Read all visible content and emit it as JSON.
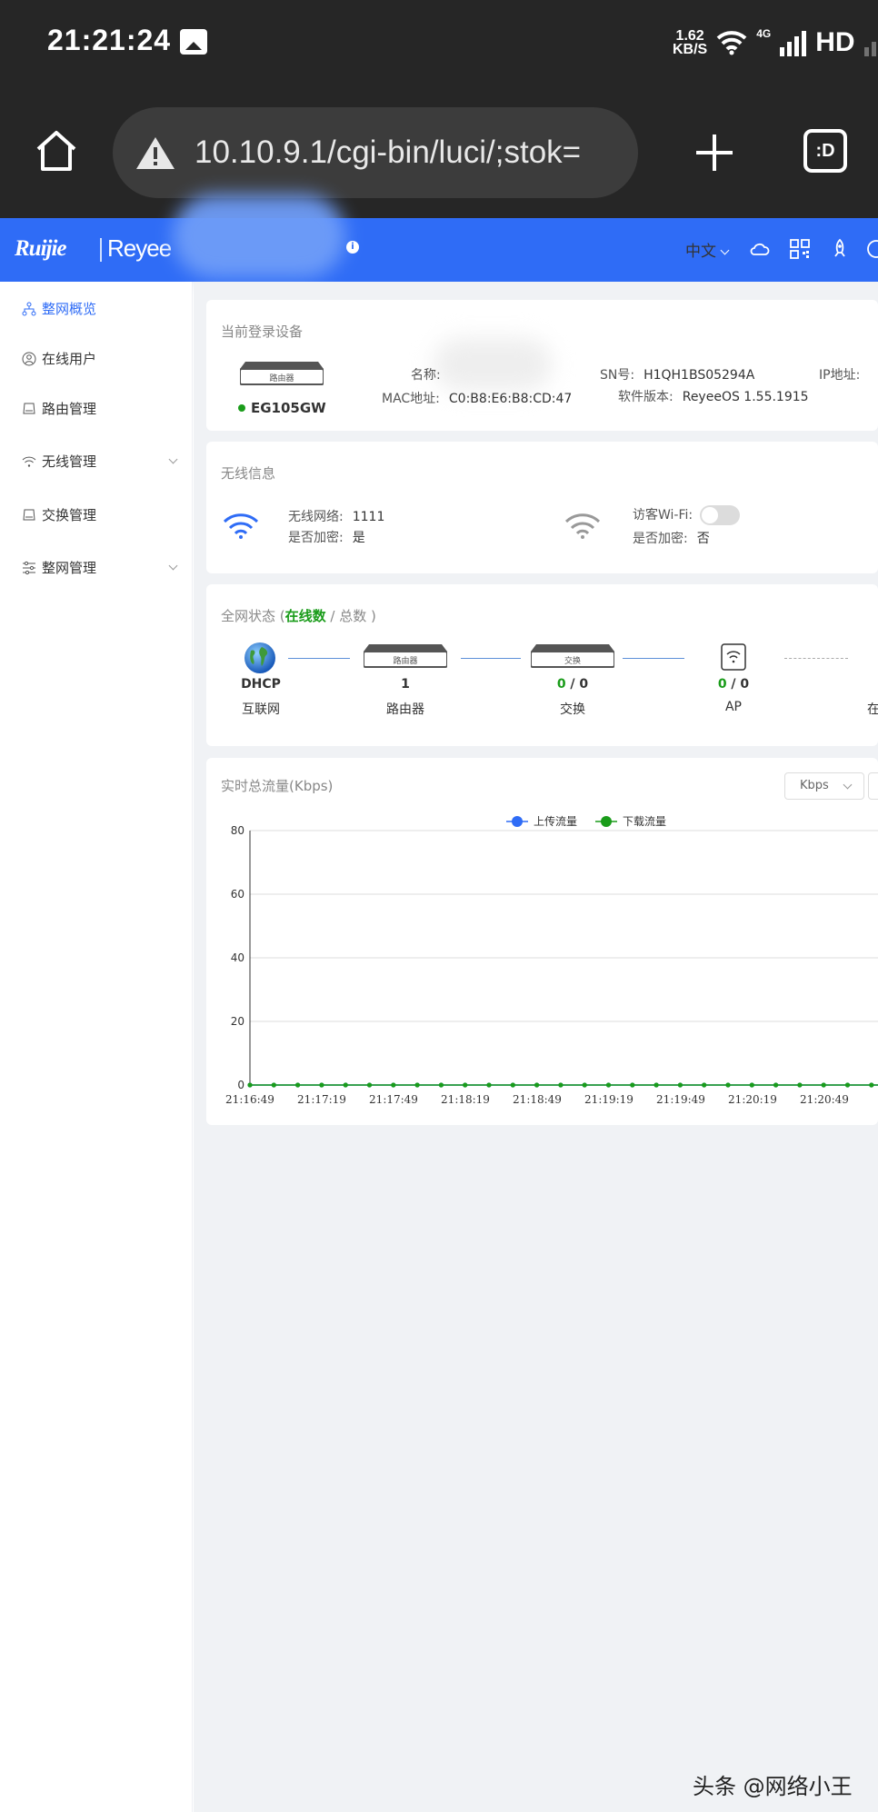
{
  "status_bar": {
    "time": "21:21:24",
    "speed_value": "1.62",
    "speed_unit": "KB/S",
    "network": "4G",
    "hd": "HD"
  },
  "browser": {
    "url": "10.10.9.1/cgi-bin/luci/;stok=",
    "tabs_label": ":D"
  },
  "header": {
    "lang": "中文"
  },
  "sidebar": {
    "items": [
      {
        "label": "整网概览",
        "icon": "topology-icon"
      },
      {
        "label": "在线用户",
        "icon": "user-icon"
      },
      {
        "label": "路由管理",
        "icon": "router-icon"
      },
      {
        "label": "无线管理",
        "icon": "wifi-icon"
      },
      {
        "label": "交换管理",
        "icon": "switch-icon"
      },
      {
        "label": "整网管理",
        "icon": "settings-icon"
      }
    ]
  },
  "device": {
    "title": "当前登录设备",
    "img_label": "路由器",
    "model": "EG105GW",
    "name_label": "名称:",
    "mac_label": "MAC地址:",
    "mac": "C0:B8:E6:B8:CD:47",
    "sn_label": "SN号:",
    "sn": "H1QH1BS05294A",
    "sw_label": "软件版本:",
    "sw": "ReyeeOS 1.55.1915",
    "ip_label": "IP地址:"
  },
  "wireless": {
    "title": "无线信息",
    "net_label": "无线网络:",
    "net": "1111",
    "enc_label": "是否加密:",
    "enc": "是",
    "guest_label": "访客Wi-Fi:",
    "guest_enc_label": "是否加密:",
    "guest_enc": "否"
  },
  "network_status": {
    "title_prefix": "全网状态 (",
    "title_online": "在线数",
    "title_suffix": " / 总数 )",
    "nodes": [
      {
        "value": "DHCP",
        "label": "互联网"
      },
      {
        "value": "1",
        "label": "路由器",
        "img_label": "路由器"
      },
      {
        "online": "0",
        "total": " / 0",
        "label": "交换",
        "img_label": "交换"
      },
      {
        "online": "0",
        "total": " / 0",
        "label": "AP"
      },
      {
        "label": "在"
      }
    ]
  },
  "traffic": {
    "title": "实时总流量(Kbps)",
    "unit": "Kbps"
  },
  "chart_data": {
    "type": "line",
    "title": "",
    "ylim": [
      0,
      80
    ],
    "yticks": [
      0,
      20,
      40,
      60,
      80
    ],
    "x": [
      "21:16:49",
      "21:17:19",
      "21:17:49",
      "21:18:19",
      "21:18:49",
      "21:19:19",
      "21:19:49",
      "21:20:19",
      "21:20:49",
      "2"
    ],
    "series": [
      {
        "name": "上传流量",
        "color": "#2f6cf6",
        "values": [
          0,
          0,
          0,
          0,
          0,
          0,
          0,
          0,
          0,
          0,
          0,
          0,
          0,
          0,
          0,
          0,
          0,
          0,
          0,
          0,
          0,
          0,
          0,
          0,
          0,
          0,
          0,
          0
        ]
      },
      {
        "name": "下载流量",
        "color": "#1a9c1a",
        "values": [
          0,
          0,
          0,
          0,
          0,
          0,
          0,
          0,
          0,
          0,
          0,
          0,
          0,
          0,
          0,
          0,
          0,
          0,
          0,
          0,
          0,
          0,
          0,
          0,
          0,
          0,
          0,
          0
        ]
      }
    ]
  },
  "watermark": "头条 @网络小王"
}
